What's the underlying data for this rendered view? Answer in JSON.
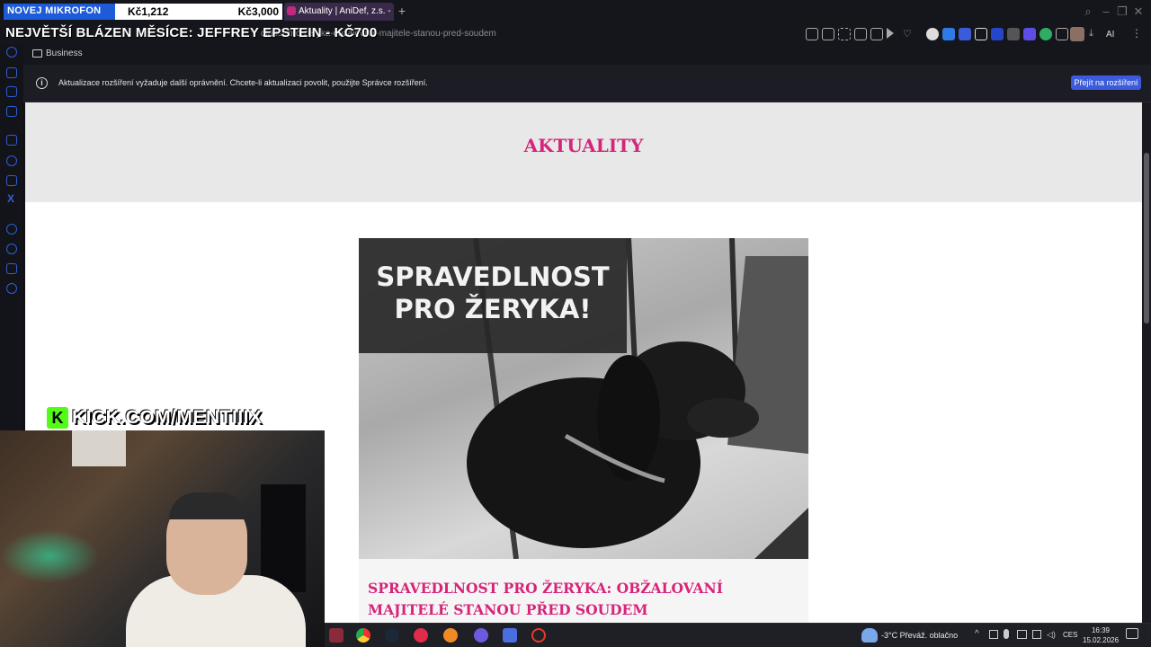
{
  "stream": {
    "mic_goal_label": "NOVEJ MIKROFON",
    "mic_goal_current": "Kč1,212",
    "mic_goal_target": "Kč3,000",
    "title_overlay": "NEJVĚTŠÍ BLÁZEN MĚSÍCE: JEFFREY EPSTEIN - KČ700",
    "kick_url": "KICK.COM/MENTIIIX"
  },
  "browser": {
    "tab_title": "Aktuality | AniDef, z.s. - úč",
    "url": "dlnost-pro-zeryka-obzalovani-majitele-stanou-pred-soudem",
    "bookmark_folder": "Business",
    "ai_label": "AI"
  },
  "infobar": {
    "message": "Aktualizace rozšíření vyžaduje další oprávnění. Chcete-li aktualizaci povolit, použijte Správce rozšíření.",
    "button_label": "Přejít na rozšíření"
  },
  "page": {
    "heading": "AKTUALITY",
    "image_text": "SPRAVEDLNOST PRO ŽERYKA!",
    "article_title": "SPRAVEDLNOST PRO ŽERYKA: OBŽALOVANÍ MAJITELÉ STANOU PŘED SOUDEM"
  },
  "taskbar": {
    "weather": "-3°C  Převáž. oblačno",
    "language": "CES",
    "time": "16:39",
    "date": "15.02.2026"
  },
  "colors": {
    "accent_pink": "#d6247a",
    "kick_green": "#53fc18",
    "button_blue": "#3b5bdb"
  }
}
